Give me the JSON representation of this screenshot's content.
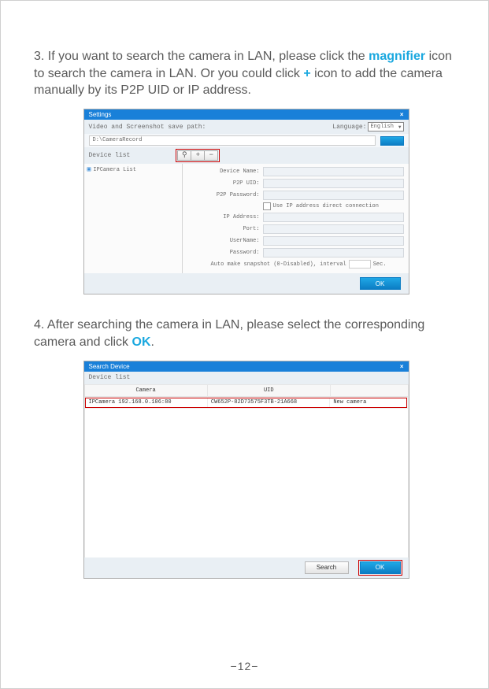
{
  "step3": {
    "prefix": "3. If you want to search the camera in LAN, please click the ",
    "magnifier": "magnifier",
    "mid1": " icon to search the camera in LAN. Or you could click ",
    "plus": "+",
    "mid2": " icon to add the camera manually by its P2P UID or IP address."
  },
  "win1": {
    "title": "Settings",
    "close": "×",
    "path_label": "Video and Screenshot save path:",
    "lang_label": "Language:",
    "lang_value": "English",
    "path_value": "D:\\CameraRecord",
    "device_list_label": "Device list",
    "tools": {
      "search": "⚲",
      "add": "+",
      "remove": "−"
    },
    "tree_item": "IPCamera List",
    "form": {
      "device_name": "Device Name:",
      "p2p_uid": "P2P UID:",
      "p2p_password": "P2P Password:",
      "use_ip": "Use IP address direct connection",
      "ip_address": "IP Address:",
      "port": "Port:",
      "username": "UserName:",
      "password": "Password:",
      "snapshot_pre": "Auto make snapshot (0-Disabled), interval",
      "snapshot_post": "Sec."
    },
    "ok": "OK"
  },
  "step4": {
    "prefix": "4. After searching the camera in LAN, please select the corresponding camera and click ",
    "ok_word": "OK",
    "suffix": "."
  },
  "win2": {
    "title": "Search Device",
    "close": "×",
    "device_list_label": "Device list",
    "headers": {
      "camera": "Camera",
      "uid": "UID",
      "status": ""
    },
    "row": {
      "camera": "IPCamera 192.168.0.106:80",
      "uid": "CW652P-82D73575F3TB-21A668",
      "status": "New camera"
    },
    "search": "Search",
    "ok": "OK"
  },
  "page_number": "12"
}
